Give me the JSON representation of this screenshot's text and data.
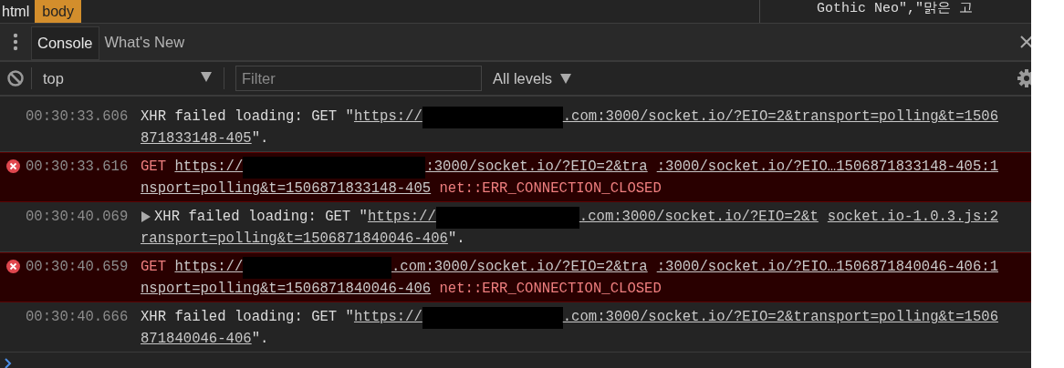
{
  "breadcrumbs": [
    {
      "label": "html",
      "selected": false
    },
    {
      "label": "body",
      "selected": true
    }
  ],
  "styles_pane": {
    "text": "Gothic Neo\",\"맑은 고"
  },
  "tabs": [
    {
      "label": "Console",
      "selected": true
    },
    {
      "label": "What's New",
      "selected": false
    }
  ],
  "toolbar": {
    "context": "top",
    "filter_placeholder": "Filter",
    "levels": "All levels"
  },
  "messages": [
    {
      "kind": "log",
      "expandable": false,
      "time": "00:30:33.606",
      "lines": [
        [
          {
            "kind": "text",
            "text": "XHR failed loading: GET \""
          },
          {
            "kind": "link",
            "text": "https://"
          },
          {
            "kind": "redaction"
          },
          {
            "kind": "link",
            "text": ".com:3000/socket.io/?EIO=2&transport=polling&t=1506"
          }
        ],
        [
          {
            "kind": "link",
            "text": "871833148-405"
          },
          {
            "kind": "text",
            "text": "\"."
          }
        ]
      ]
    },
    {
      "kind": "error",
      "expandable": false,
      "time": "00:30:33.616",
      "source": ":3000/socket.io/?EIO…1506871833148-405:1",
      "lines": [
        [
          {
            "kind": "method",
            "text": "GET"
          },
          {
            "kind": "link",
            "text": "https://"
          },
          {
            "kind": "redaction"
          },
          {
            "kind": "link",
            "text": ":3000/socket.io/?EIO=2&tra"
          }
        ],
        [
          {
            "kind": "link",
            "text": "nsport=polling&t=1506871833148-405"
          },
          {
            "kind": "status",
            "text": "net::ERR_CONNECTION_CLOSED"
          }
        ]
      ]
    },
    {
      "kind": "log",
      "expandable": true,
      "time": "00:30:40.069",
      "source": "socket.io-1.0.3.js:2",
      "lines": [
        [
          {
            "kind": "text",
            "text": "XHR failed loading: GET \""
          },
          {
            "kind": "link",
            "text": "https://"
          },
          {
            "kind": "redaction"
          },
          {
            "kind": "link",
            "text": ".com:3000/socket.io/?EIO=2&t"
          }
        ],
        [
          {
            "kind": "link",
            "text": "ransport=polling&t=1506871840046-406"
          },
          {
            "kind": "text",
            "text": "\"."
          }
        ]
      ]
    },
    {
      "kind": "error",
      "expandable": false,
      "time": "00:30:40.659",
      "source": ":3000/socket.io/?EIO…1506871840046-406:1",
      "lines": [
        [
          {
            "kind": "method",
            "text": "GET"
          },
          {
            "kind": "link",
            "text": "https://"
          },
          {
            "kind": "redaction"
          },
          {
            "kind": "link",
            "text": ".com:3000/socket.io/?EIO=2&tra"
          }
        ],
        [
          {
            "kind": "link",
            "text": "nsport=polling&t=1506871840046-406"
          },
          {
            "kind": "status",
            "text": "net::ERR_CONNECTION_CLOSED"
          }
        ]
      ]
    },
    {
      "kind": "log",
      "expandable": false,
      "time": "00:30:40.666",
      "lines": [
        [
          {
            "kind": "text",
            "text": "XHR failed loading: GET \""
          },
          {
            "kind": "link",
            "text": "https://"
          },
          {
            "kind": "redaction"
          },
          {
            "kind": "link",
            "text": ".com:3000/socket.io/?EIO=2&transport=polling&t=1506"
          }
        ],
        [
          {
            "kind": "link",
            "text": "871840046-406"
          },
          {
            "kind": "text",
            "text": "\"."
          }
        ]
      ]
    }
  ]
}
